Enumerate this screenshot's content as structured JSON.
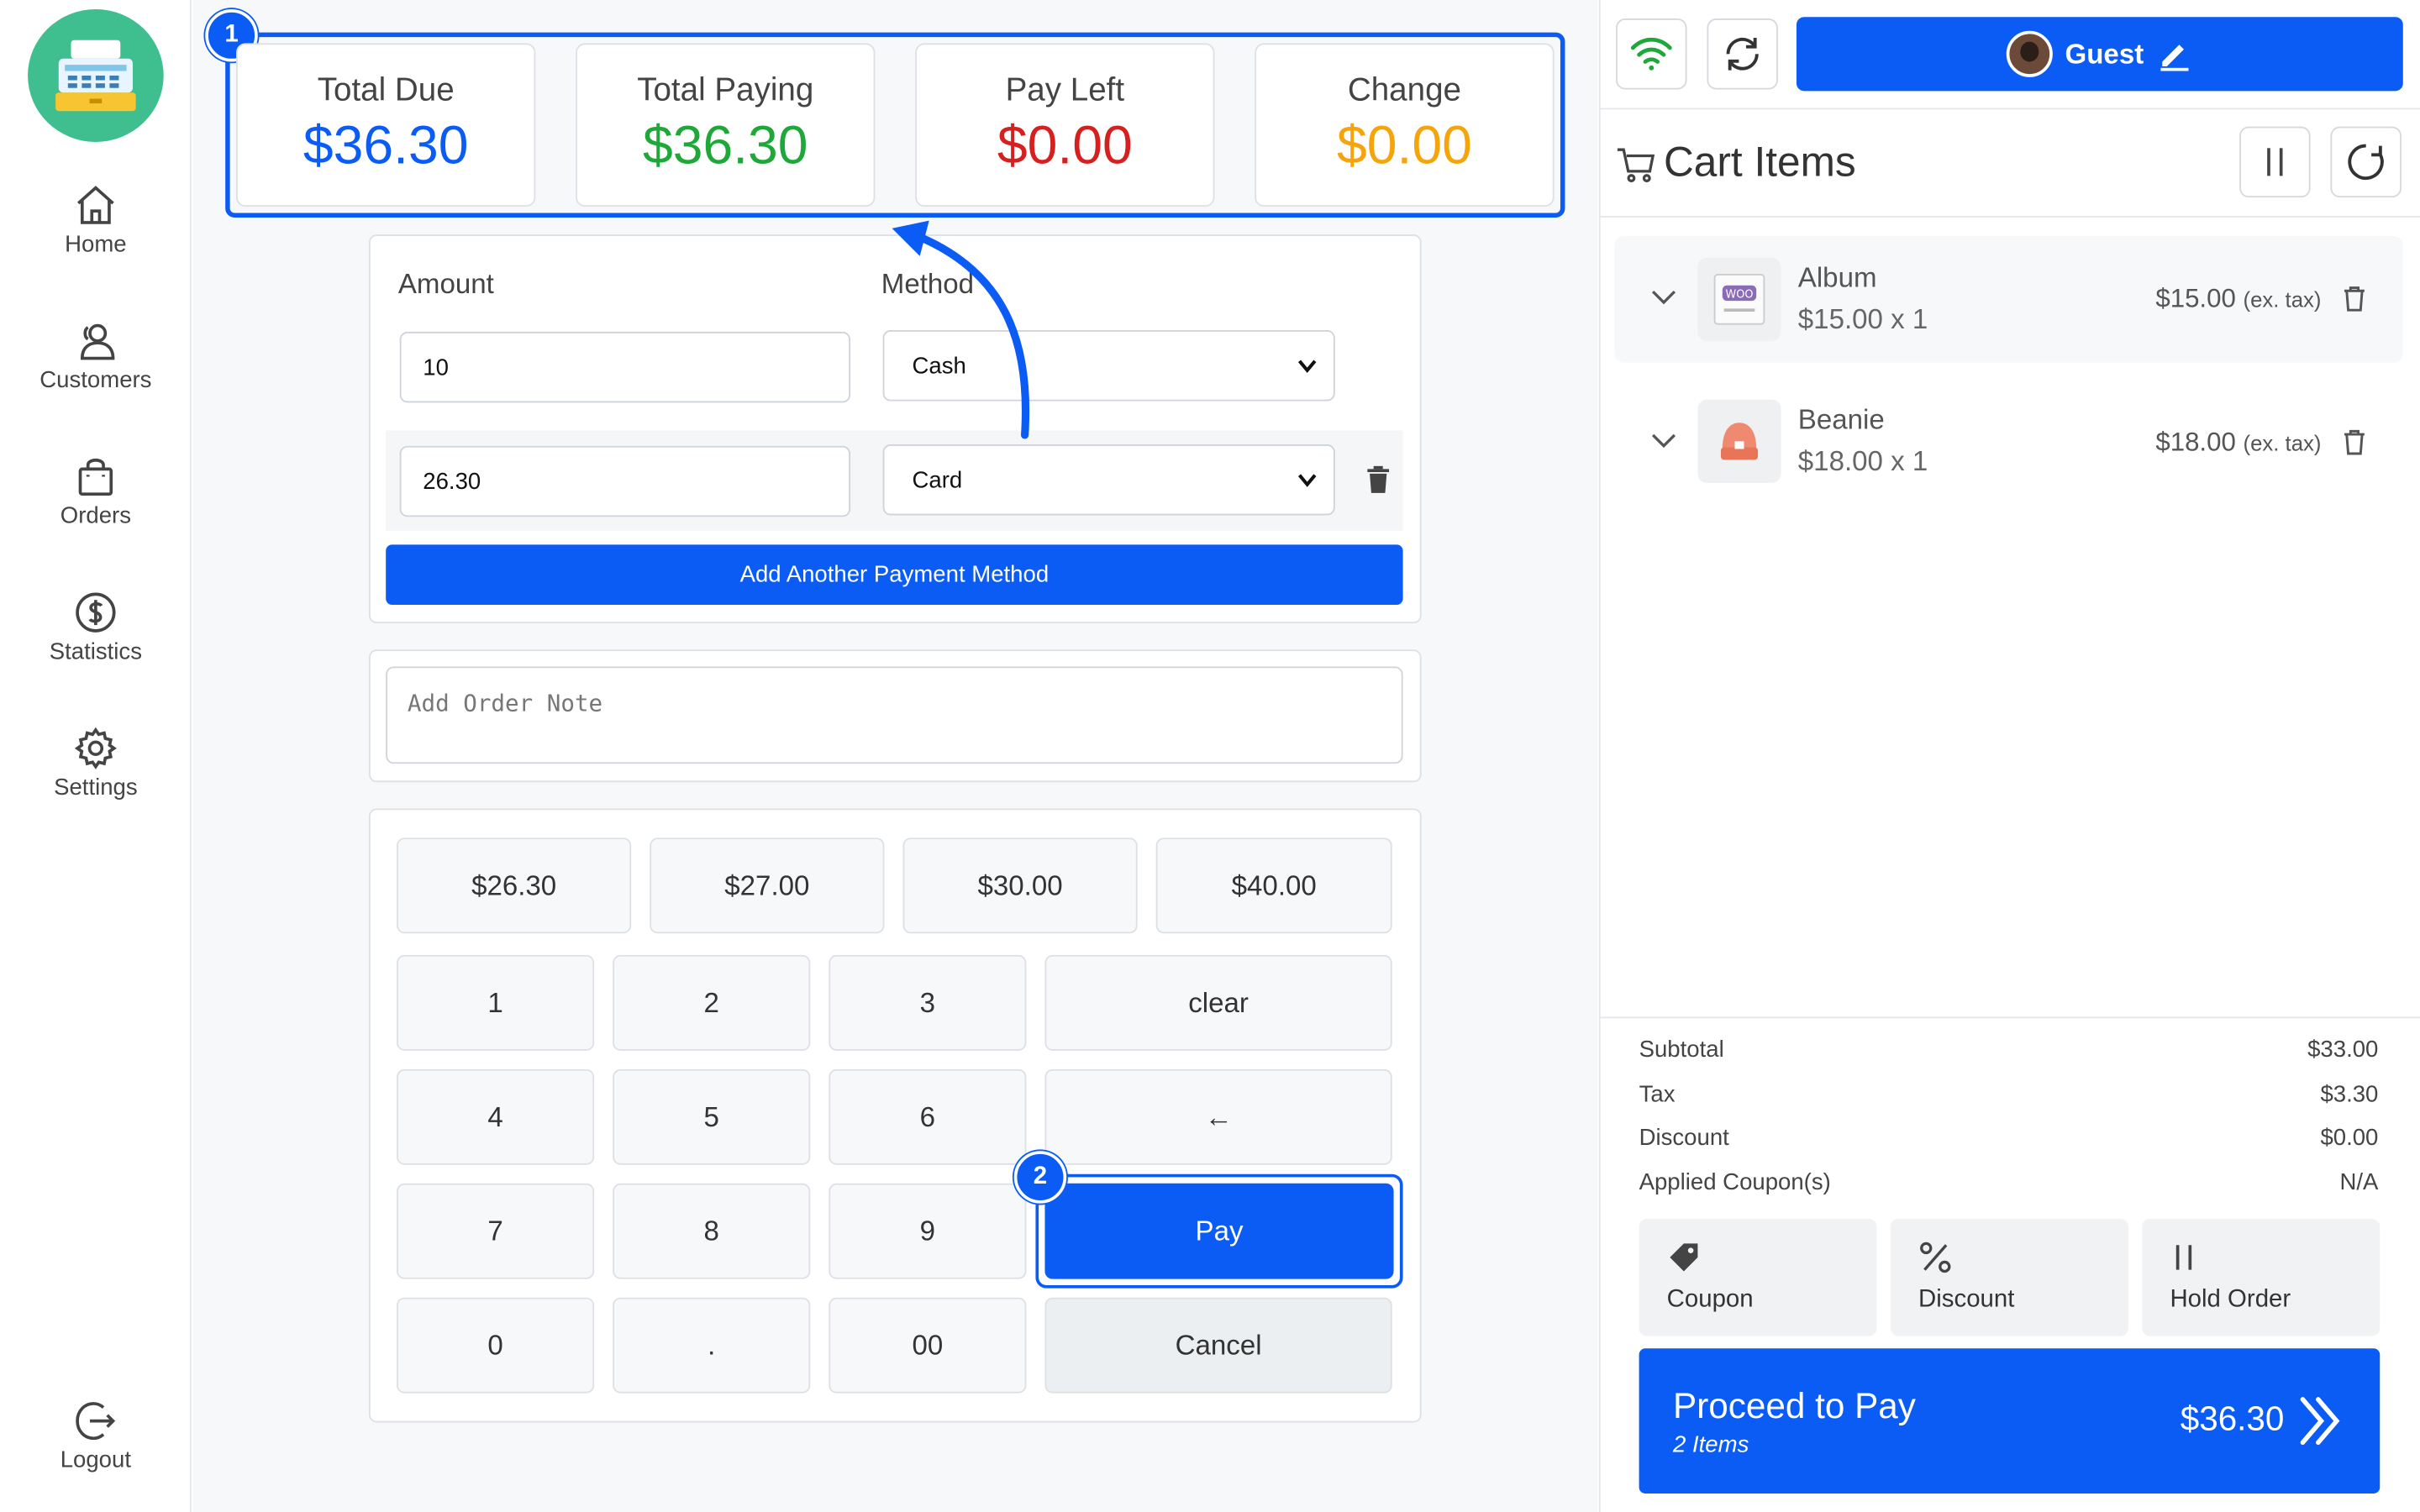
{
  "sidebar": {
    "logo_icon": "cash-register-icon",
    "items": [
      {
        "label": "Home",
        "icon": "home-icon"
      },
      {
        "label": "Customers",
        "icon": "customers-icon"
      },
      {
        "label": "Orders",
        "icon": "shopping-bag-icon"
      },
      {
        "label": "Statistics",
        "icon": "dollar-circle-icon"
      },
      {
        "label": "Settings",
        "icon": "gear-icon"
      }
    ],
    "logout_label": "Logout"
  },
  "totals": {
    "badge": "1",
    "cards": [
      {
        "label": "Total Due",
        "value": "$36.30",
        "color": "#0b5cf5"
      },
      {
        "label": "Total Paying",
        "value": "$36.30",
        "color": "#1fa83a"
      },
      {
        "label": "Pay Left",
        "value": "$0.00",
        "color": "#d61f1f"
      },
      {
        "label": "Change",
        "value": "$0.00",
        "color": "#f5a40b"
      }
    ]
  },
  "payment": {
    "amount_label": "Amount",
    "method_label": "Method",
    "rows": [
      {
        "amount": "10",
        "method": "Cash"
      },
      {
        "amount": "26.30",
        "method": "Card"
      }
    ],
    "add_button": "Add Another Payment Method"
  },
  "order_note": {
    "placeholder": "Add Order Note"
  },
  "keypad": {
    "quick_amounts": [
      "$26.30",
      "$27.00",
      "$30.00",
      "$40.00"
    ],
    "digits": [
      "1",
      "2",
      "3",
      "4",
      "5",
      "6",
      "7",
      "8",
      "9",
      "0",
      ".",
      "00"
    ],
    "clear": "clear",
    "backspace": "←",
    "pay": "Pay",
    "pay_badge": "2",
    "cancel": "Cancel"
  },
  "header": {
    "guest_label": "Guest"
  },
  "cart": {
    "title": "Cart Items",
    "items": [
      {
        "name": "Album",
        "sub": "$15.00 x 1",
        "price": "$15.00",
        "tax_note": "(ex. tax)",
        "thumb": "woo-album-icon"
      },
      {
        "name": "Beanie",
        "sub": "$18.00 x 1",
        "price": "$18.00",
        "tax_note": "(ex. tax)",
        "thumb": "beanie-icon"
      }
    ]
  },
  "summary": [
    {
      "label": "Subtotal",
      "value": "$33.00"
    },
    {
      "label": "Tax",
      "value": "$3.30"
    },
    {
      "label": "Discount",
      "value": "$0.00"
    },
    {
      "label": "Applied Coupon(s)",
      "value": "N/A"
    }
  ],
  "actions": [
    {
      "label": "Coupon",
      "icon": "tag-icon"
    },
    {
      "label": "Discount",
      "icon": "percent-icon"
    },
    {
      "label": "Hold Order",
      "icon": "pause-icon"
    }
  ],
  "proceed": {
    "label": "Proceed to Pay",
    "items": "2 Items",
    "amount": "$36.30"
  },
  "colors": {
    "accent": "#0b5cf5",
    "wifi": "#1fa83a",
    "logo_bg": "#3fbf8f"
  }
}
